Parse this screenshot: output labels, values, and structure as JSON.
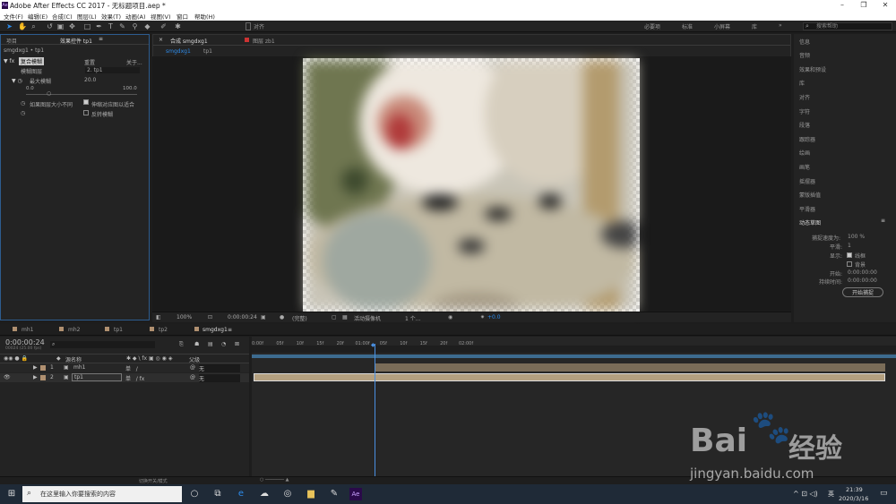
{
  "app": {
    "title": "Adobe After Effects CC 2017 - 无标题项目.aep *",
    "logo": "Ae"
  },
  "window_controls": {
    "minimize": "–",
    "maximize": "❐",
    "close": "✕"
  },
  "menu": [
    "文件(F)",
    "编辑(E)",
    "合成(C)",
    "图层(L)",
    "效果(T)",
    "动画(A)",
    "视图(V)",
    "窗口",
    "帮助(H)"
  ],
  "toolbar": {
    "align_label": "对齐",
    "workspaces": [
      "必要项",
      "标准",
      "小屏幕",
      "库"
    ],
    "search_placeholder": "搜索帮助"
  },
  "project_panel": {
    "tab_project": "项目",
    "tab_effects": "效果控件 tp1",
    "breadcrumb": "smgdxg1 • tp1",
    "effect_name": "复合模糊",
    "reset": "重置",
    "about": "关于...",
    "blur_layer_label": "模糊图层",
    "blur_layer_value": "2. tp1",
    "max_blur_label": "最大模糊",
    "max_blur_value": "20.0",
    "slider_min": "0.0",
    "slider_max": "100.0",
    "stretch_label": "如果图层大小不同",
    "stretch_option": "伸缩对应图以适合",
    "invert_label": "反转模糊"
  },
  "comp_panel": {
    "tab_comp": "合成 smgdxg1",
    "tab_layer": "图层 zb1",
    "crumb1": "smgdxg1",
    "crumb2": "tp1",
    "zoom": "100%",
    "timecode": "0:00:00:24",
    "resolution": "(完整)",
    "camera": "活动摄像机",
    "views": "1 个...",
    "exposure": "+0.0"
  },
  "right_panel": {
    "items": [
      "信息",
      "音频",
      "效果和预设",
      "库",
      "对齐",
      "字符",
      "段落",
      "跟踪器",
      "绘画",
      "画笔",
      "摇摆器",
      "蒙版插值",
      "平滑器",
      "动态草图"
    ],
    "capture_speed_label": "捕捉速度为:",
    "capture_speed_value": "100 %",
    "smoothing_label": "平滑:",
    "smoothing_value": "1",
    "display_label": "显示:",
    "wireframe": "线框",
    "background": "背景",
    "start_label": "开始:",
    "start_value": "0:00:00:00",
    "duration_label": "持续时间:",
    "duration_value": "0:00:00:00",
    "start_capture": "开始捕捉"
  },
  "timeline": {
    "tabs": [
      "mh1",
      "mh2",
      "tp1",
      "tp2",
      "smgdxg1"
    ],
    "timecode": "0:00:00:24",
    "fps_note": "00024 (25.00 fps)",
    "col_source": "源名称",
    "col_parent": "父级",
    "layers": [
      {
        "num": "1",
        "name": "mh1",
        "parent": "无"
      },
      {
        "num": "2",
        "name": "tp1",
        "parent": "无"
      }
    ],
    "ruler": [
      "0:00f",
      "05f",
      "10f",
      "15f",
      "20f",
      "01:00f",
      "05f",
      "10f",
      "15f",
      "20f",
      "02:00f",
      "05f",
      "10f",
      "15f",
      "20f",
      "03:00f",
      "05f",
      "10f",
      "15f",
      "20f",
      "04:00f",
      "05f",
      "10f",
      "15f",
      "20f",
      "05:0"
    ],
    "status": "切换开关/模式"
  },
  "taskbar": {
    "search_placeholder": "在这里输入你要搜索的内容",
    "time": "21:39",
    "date": "2020/3/16",
    "lang": "英"
  },
  "watermark": {
    "brand": "Bai",
    "brand2": "经验",
    "url": "jingyan.baidu.com"
  }
}
